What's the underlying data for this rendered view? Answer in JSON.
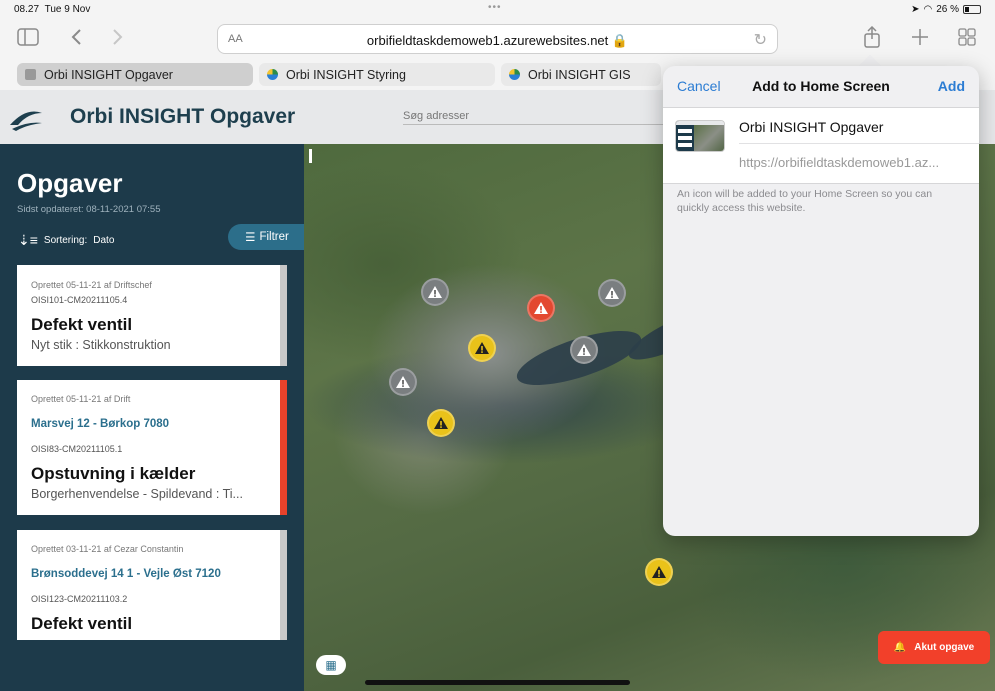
{
  "status": {
    "time": "08.27",
    "date": "Tue 9 Nov",
    "battery": "26 %",
    "multitask_dots": "•••"
  },
  "browser": {
    "url": "orbifieldtaskdemoweb1.azurewebsites.net 🔒",
    "aa_label": "AA",
    "tabs": [
      {
        "label": "Orbi INSIGHT Opgaver",
        "active": true
      },
      {
        "label": "Orbi INSIGHT Styring",
        "active": false
      },
      {
        "label": "Orbi INSIGHT GIS",
        "active": false
      }
    ]
  },
  "app": {
    "title": "Orbi INSIGHT Opgaver",
    "search_placeholder": "Søg adresser"
  },
  "sidebar": {
    "title": "Opgaver",
    "updated": "Sidst opdateret: 08-11-2021 07:55",
    "sort_label": "Sortering:",
    "sort_value": "Dato",
    "filter_label": "Filtrer",
    "cards": [
      {
        "meta": "Oprettet 05-11-21 af Driftschef",
        "address": "",
        "id": "OISI101-CM20211105.4",
        "name": "Defekt ventil",
        "sub": "Nyt stik : Stikkonstruktion",
        "stripe": "grey"
      },
      {
        "meta": "Oprettet 05-11-21 af Drift",
        "address": "Marsvej 12 - Børkop 7080",
        "id": "OISI83-CM20211105.1",
        "name": "Opstuvning i kælder",
        "sub": "Borgerhenvendelse - Spildevand : Ti...",
        "stripe": "red"
      },
      {
        "meta": "Oprettet 03-11-21 af Cezar Constantin",
        "address": "Brønsoddevej 14 1 - Vejle Øst 7120",
        "id": "OISI123-CM20211103.2",
        "name": "Defekt ventil",
        "sub": "",
        "stripe": "grey"
      }
    ]
  },
  "map": {
    "akut_label": "Akut opgave",
    "markers": [
      {
        "status": "grey"
      },
      {
        "status": "red"
      },
      {
        "status": "grey"
      },
      {
        "status": "yellow"
      },
      {
        "status": "grey"
      },
      {
        "status": "grey"
      },
      {
        "status": "yellow"
      },
      {
        "status": "yellow"
      }
    ]
  },
  "popover": {
    "cancel": "Cancel",
    "title": "Add to Home Screen",
    "add": "Add",
    "app_name": "Orbi INSIGHT Opgaver",
    "app_url": "https://orbifieldtaskdemoweb1.az...",
    "note": "An icon will be added to your Home Screen so you can quickly access this website."
  },
  "colors": {
    "sidebar": "#1d3a4a",
    "accent": "#2b6f8d",
    "alert": "#f2402a",
    "link": "#2b7cd3"
  }
}
